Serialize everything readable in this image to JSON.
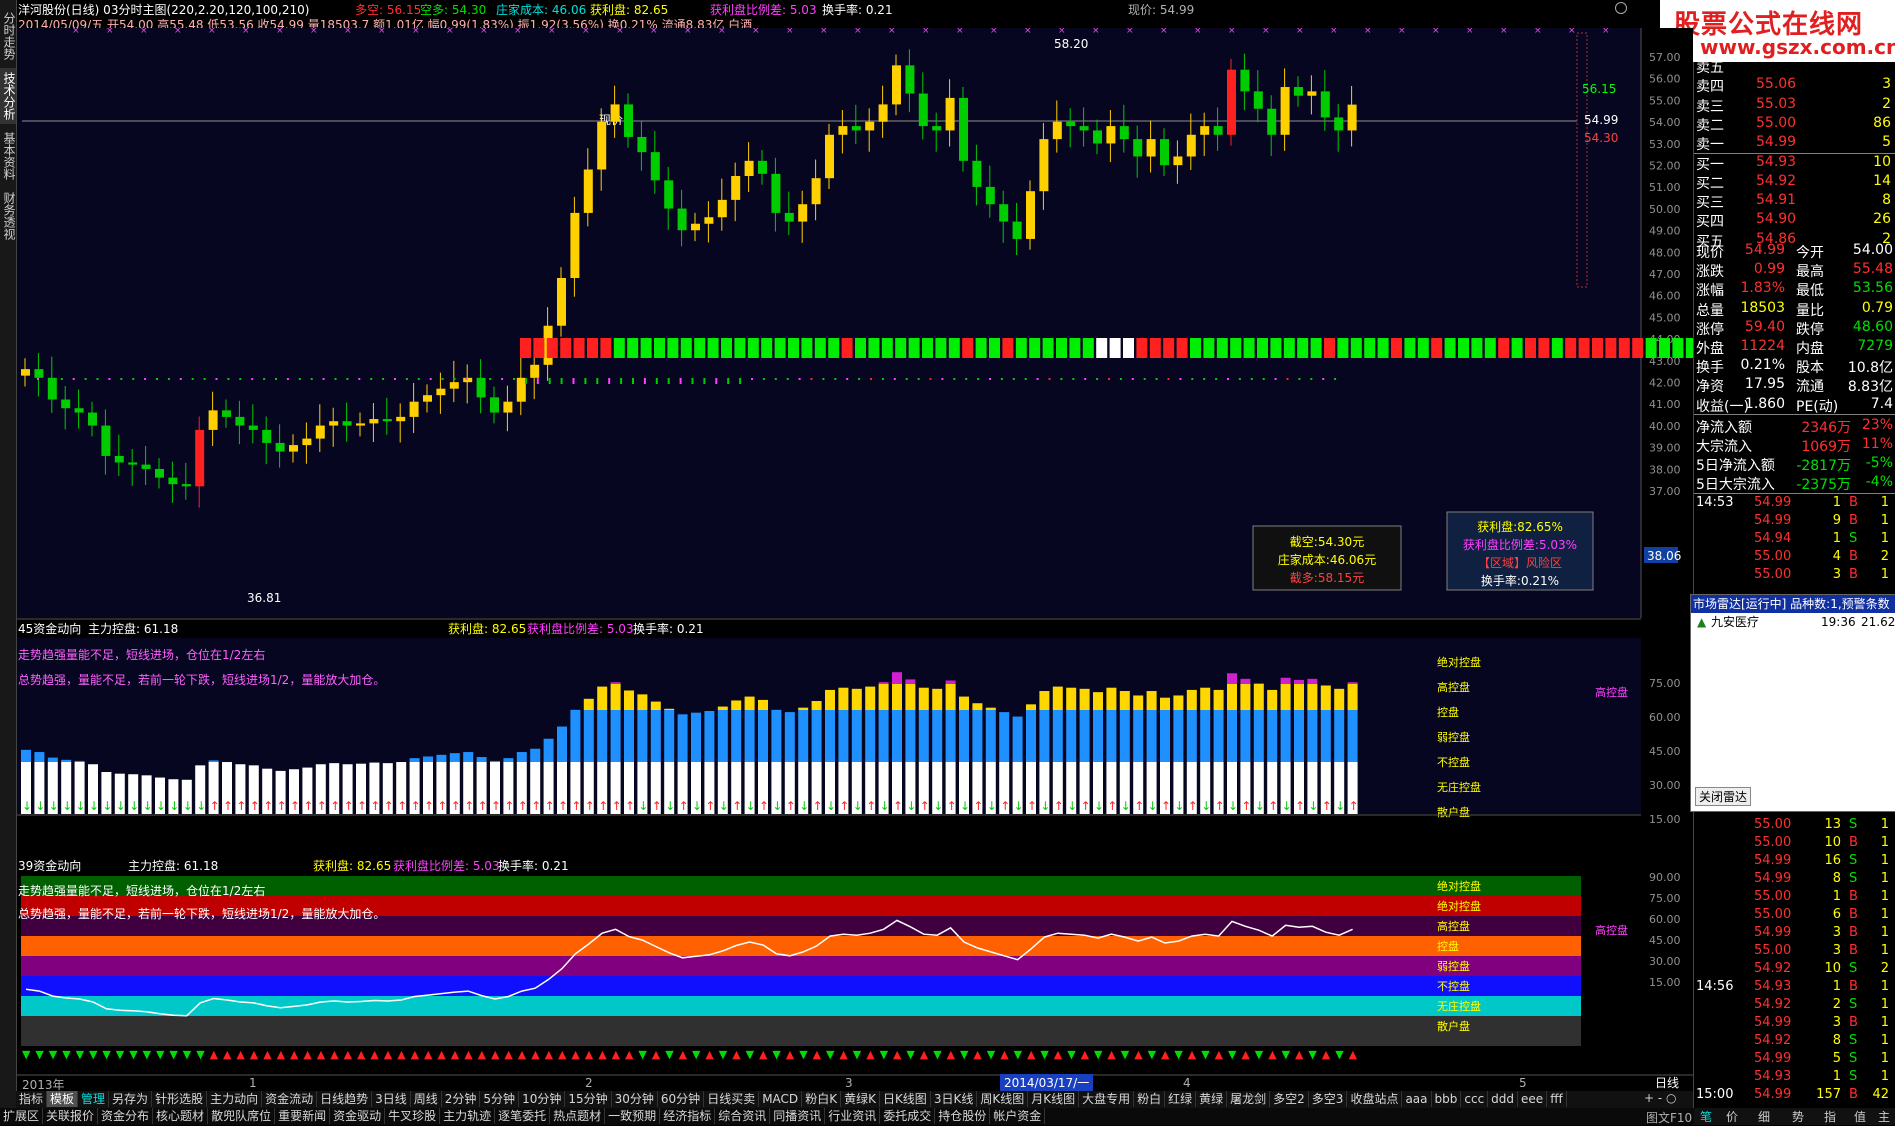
{
  "window": {
    "title": "洋河股份(日线) 03分时主图(220,2.20,120,100,210)",
    "info_line": "2014/05/09/五 开54.00 高55.48 低53.56 收54.99 量18503.7 额1.01亿 幅0.99(1.83%) 振1.92(3.56%) 换0.21% 流通8.83亿 白酒",
    "duokong": "多空: 56.15",
    "kongduo": "空多: 54.30",
    "zhuangjia": "庄家成本: 46.06",
    "huolipan": "获利盘: 82.65",
    "huoli_ratio": "获利盘比例差: 5.03",
    "huanshou": "换手率: 0.21",
    "xianjia": "现价: 54.99"
  },
  "left_tabs": [
    "分时走势",
    "技术分析",
    "基本资料",
    "财务透视"
  ],
  "logo": {
    "line1": "股票公式在线网",
    "line2": "www.gszx.com.cn"
  },
  "main_chart": {
    "price_ticks": [
      "57.00",
      "56.00",
      "55.00",
      "54.00",
      "53.00",
      "52.00",
      "51.00",
      "50.00",
      "49.00",
      "48.00",
      "47.00",
      "46.00",
      "45.00",
      "44.00",
      "43.00",
      "42.00",
      "41.00",
      "40.00",
      "39.00",
      "38.00",
      "37.00"
    ],
    "high_label": "58.20",
    "low_label": "36.81",
    "current_label": "现价",
    "current_box": "38.06",
    "right_labels": {
      "a": "56.15",
      "b": "54.99",
      "c": "54.30"
    },
    "box_left": {
      "l1": "截空:54.30元",
      "l2": "庄家成本:46.06元",
      "l3": "截多:58.15元"
    },
    "box_right": {
      "l1": "获利盘:82.65%",
      "l2": "获利盘比例差:5.03%",
      "l3": "【区域】风险区",
      "l4": "换手率:0.21%"
    }
  },
  "sub1": {
    "title": "45资金动向",
    "zhukong": "主力控盘: 61.18",
    "huolipan": "获利盘: 82.65",
    "ratio": "获利盘比例差: 5.03",
    "huanshou": "换手率: 0.21",
    "note1": "走势趋强量能不足，短线进场，仓位在1/2左右",
    "note2": "总势趋强，量能不足，若前一轮下跌，短线进场1/2，量能放大加仓。",
    "ticks": [
      "75.00",
      "60.00",
      "45.00",
      "30.00",
      "15.00"
    ],
    "levels": [
      "绝对控盘",
      "高控盘",
      "控盘",
      "弱控盘",
      "不控盘",
      "无庄控盘",
      "散户盘"
    ],
    "right_label": "高控盘"
  },
  "sub2": {
    "title": "39资金动向",
    "zhukong": "主力控盘: 61.18",
    "huolipan": "获利盘: 82.65",
    "ratio": "获利盘比例差: 5.03",
    "huanshou": "换手率: 0.21",
    "note1": "走势趋强量能不足，短线进场，仓位在1/2左右",
    "note2": "总势趋强，量能不足，若前一轮下跌，短线进场1/2，量能放大加仓。",
    "ticks": [
      "90.00",
      "75.00",
      "60.00",
      "45.00",
      "30.00",
      "15.00"
    ],
    "bands": [
      "绝对控盘",
      "绝对控盘",
      "高控盘",
      "控盘",
      "弱控盘",
      "不控盘",
      "无庄控盘",
      "散户盘"
    ],
    "right_label": "高控盘"
  },
  "time_axis": {
    "start": "2013年",
    "marks": [
      "1",
      "2",
      "3",
      "4",
      "5"
    ],
    "highlight": "2014/03/17/一",
    "mode": "日线"
  },
  "indicator_tabs": [
    "指标",
    "模板",
    "管理",
    "另存为",
    "针形选股",
    "主力动向",
    "资金流动",
    "日线趋势",
    "3日线",
    "周线",
    "2分钟",
    "5分钟",
    "10分钟",
    "15分钟",
    "30分钟",
    "60分钟",
    "日线买卖",
    "MACD",
    "粉白K",
    "黄绿K",
    "日K线图",
    "3日K线",
    "周K线图",
    "月K线图",
    "大盘专用",
    "粉白",
    "红绿",
    "黄绿",
    "屠龙剑",
    "多空2",
    "多空3",
    "收盘站点",
    "aaa",
    "bbb",
    "ccc",
    "ddd",
    "eee",
    "fff"
  ],
  "status_tabs": [
    "扩展区",
    "关联报价",
    "资金分布",
    "核心题材",
    "散兜队席位",
    "重要新闻",
    "资金驱动",
    "牛叉珍股",
    "主力轨迹",
    "逐笔委托",
    "热点题材",
    "一致预期",
    "经济指标",
    "综合资讯",
    "同播资讯",
    "行业资讯",
    "委托成交",
    "持仓股份",
    "帐户资金"
  ],
  "status_right": {
    "zoom": "图文F10",
    "b1": "笔",
    "b2": "价",
    "b3": "细",
    "b4": "势",
    "b5": "指",
    "b6": "值",
    "b7": "主"
  },
  "order_book": {
    "sells": [
      {
        "label": "卖五",
        "price": "",
        "vol": ""
      },
      {
        "label": "卖四",
        "price": "55.06",
        "vol": "3"
      },
      {
        "label": "卖三",
        "price": "55.03",
        "vol": "2"
      },
      {
        "label": "卖二",
        "price": "55.00",
        "vol": "86"
      },
      {
        "label": "卖一",
        "price": "54.99",
        "vol": "5"
      }
    ],
    "buys": [
      {
        "label": "买一",
        "price": "54.93",
        "vol": "10"
      },
      {
        "label": "买二",
        "price": "54.92",
        "vol": "14"
      },
      {
        "label": "买三",
        "price": "54.91",
        "vol": "8"
      },
      {
        "label": "买四",
        "price": "54.90",
        "vol": "26"
      },
      {
        "label": "买五",
        "price": "54.86",
        "vol": "2"
      }
    ]
  },
  "quote": [
    {
      "k1": "现价",
      "v1": "54.99",
      "k2": "今开",
      "v2": "54.00",
      "c1": "red",
      "c2": "wht"
    },
    {
      "k1": "涨跌",
      "v1": "0.99",
      "k2": "最高",
      "v2": "55.48",
      "c1": "red",
      "c2": "red"
    },
    {
      "k1": "涨幅",
      "v1": "1.83%",
      "k2": "最低",
      "v2": "53.56",
      "c1": "red",
      "c2": "grn"
    },
    {
      "k1": "总量",
      "v1": "18503",
      "k2": "量比",
      "v2": "0.79",
      "c1": "yel",
      "c2": "yel"
    },
    {
      "k1": "涨停",
      "v1": "59.40",
      "k2": "跌停",
      "v2": "48.60",
      "c1": "red",
      "c2": "grn"
    },
    {
      "k1": "外盘",
      "v1": "11224",
      "k2": "内盘",
      "v2": "7279",
      "c1": "red",
      "c2": "grn"
    },
    {
      "k1": "换手",
      "v1": "0.21%",
      "k2": "股本",
      "v2": "10.8亿",
      "c1": "wht",
      "c2": "wht"
    },
    {
      "k1": "净资",
      "v1": "17.95",
      "k2": "流通",
      "v2": "8.83亿",
      "c1": "wht",
      "c2": "wht"
    },
    {
      "k1": "收益(一)",
      "v1": "1.860",
      "k2": "PE(动)",
      "v2": "7.4",
      "c1": "wht",
      "c2": "wht"
    }
  ],
  "flows": [
    {
      "label": "净流入额",
      "v": "2346万",
      "p": "23%",
      "c": "red"
    },
    {
      "label": "大宗流入",
      "v": "1069万",
      "p": "11%",
      "c": "red"
    },
    {
      "label": "5日净流入额",
      "v": "-2817万",
      "p": "-5%",
      "c": "grn"
    },
    {
      "label": "5日大宗流入",
      "v": "-2375万",
      "p": "-4%",
      "c": "grn"
    }
  ],
  "ticks_top": [
    {
      "t": "14:53",
      "p": "54.99",
      "v": "1",
      "bs": "B",
      "n": "1"
    },
    {
      "t": "",
      "p": "54.99",
      "v": "9",
      "bs": "B",
      "n": "1"
    },
    {
      "t": "",
      "p": "54.94",
      "v": "1",
      "bs": "S",
      "n": "1"
    },
    {
      "t": "",
      "p": "55.00",
      "v": "4",
      "bs": "B",
      "n": "2"
    },
    {
      "t": "",
      "p": "55.00",
      "v": "3",
      "bs": "B",
      "n": "1"
    }
  ],
  "radar": {
    "title": "市场雷达[运行中] 品种数:1,预警条数",
    "item_name": "九安医疗",
    "item_time": "19:36",
    "item_price": "21.62",
    "close_btn": "关闭雷达"
  },
  "ticks_bottom": [
    {
      "t": "",
      "p": "55.00",
      "v": "13",
      "bs": "S",
      "n": "1"
    },
    {
      "t": "",
      "p": "55.00",
      "v": "10",
      "bs": "B",
      "n": "1"
    },
    {
      "t": "",
      "p": "54.99",
      "v": "16",
      "bs": "S",
      "n": "1"
    },
    {
      "t": "",
      "p": "54.99",
      "v": "8",
      "bs": "S",
      "n": "1"
    },
    {
      "t": "",
      "p": "55.00",
      "v": "1",
      "bs": "B",
      "n": "1"
    },
    {
      "t": "",
      "p": "55.00",
      "v": "6",
      "bs": "B",
      "n": "1"
    },
    {
      "t": "",
      "p": "54.99",
      "v": "3",
      "bs": "B",
      "n": "1"
    },
    {
      "t": "",
      "p": "55.00",
      "v": "3",
      "bs": "B",
      "n": "1"
    },
    {
      "t": "",
      "p": "54.92",
      "v": "10",
      "bs": "S",
      "n": "2"
    },
    {
      "t": "14:56",
      "p": "54.93",
      "v": "1",
      "bs": "B",
      "n": "1"
    },
    {
      "t": "",
      "p": "54.92",
      "v": "2",
      "bs": "S",
      "n": "1"
    },
    {
      "t": "",
      "p": "54.99",
      "v": "3",
      "bs": "B",
      "n": "1"
    },
    {
      "t": "",
      "p": "54.92",
      "v": "8",
      "bs": "S",
      "n": "1"
    },
    {
      "t": "",
      "p": "54.99",
      "v": "5",
      "bs": "S",
      "n": "1"
    },
    {
      "t": "",
      "p": "54.93",
      "v": "1",
      "bs": "S",
      "n": "1"
    },
    {
      "t": "15:00",
      "p": "54.99",
      "v": "157",
      "bs": "B",
      "n": "42"
    }
  ],
  "colors": {
    "up": "#ff2020",
    "down": "#00d000",
    "yellow": "#ffd700",
    "bg": "#000000",
    "panel": "#0b0b2a"
  }
}
